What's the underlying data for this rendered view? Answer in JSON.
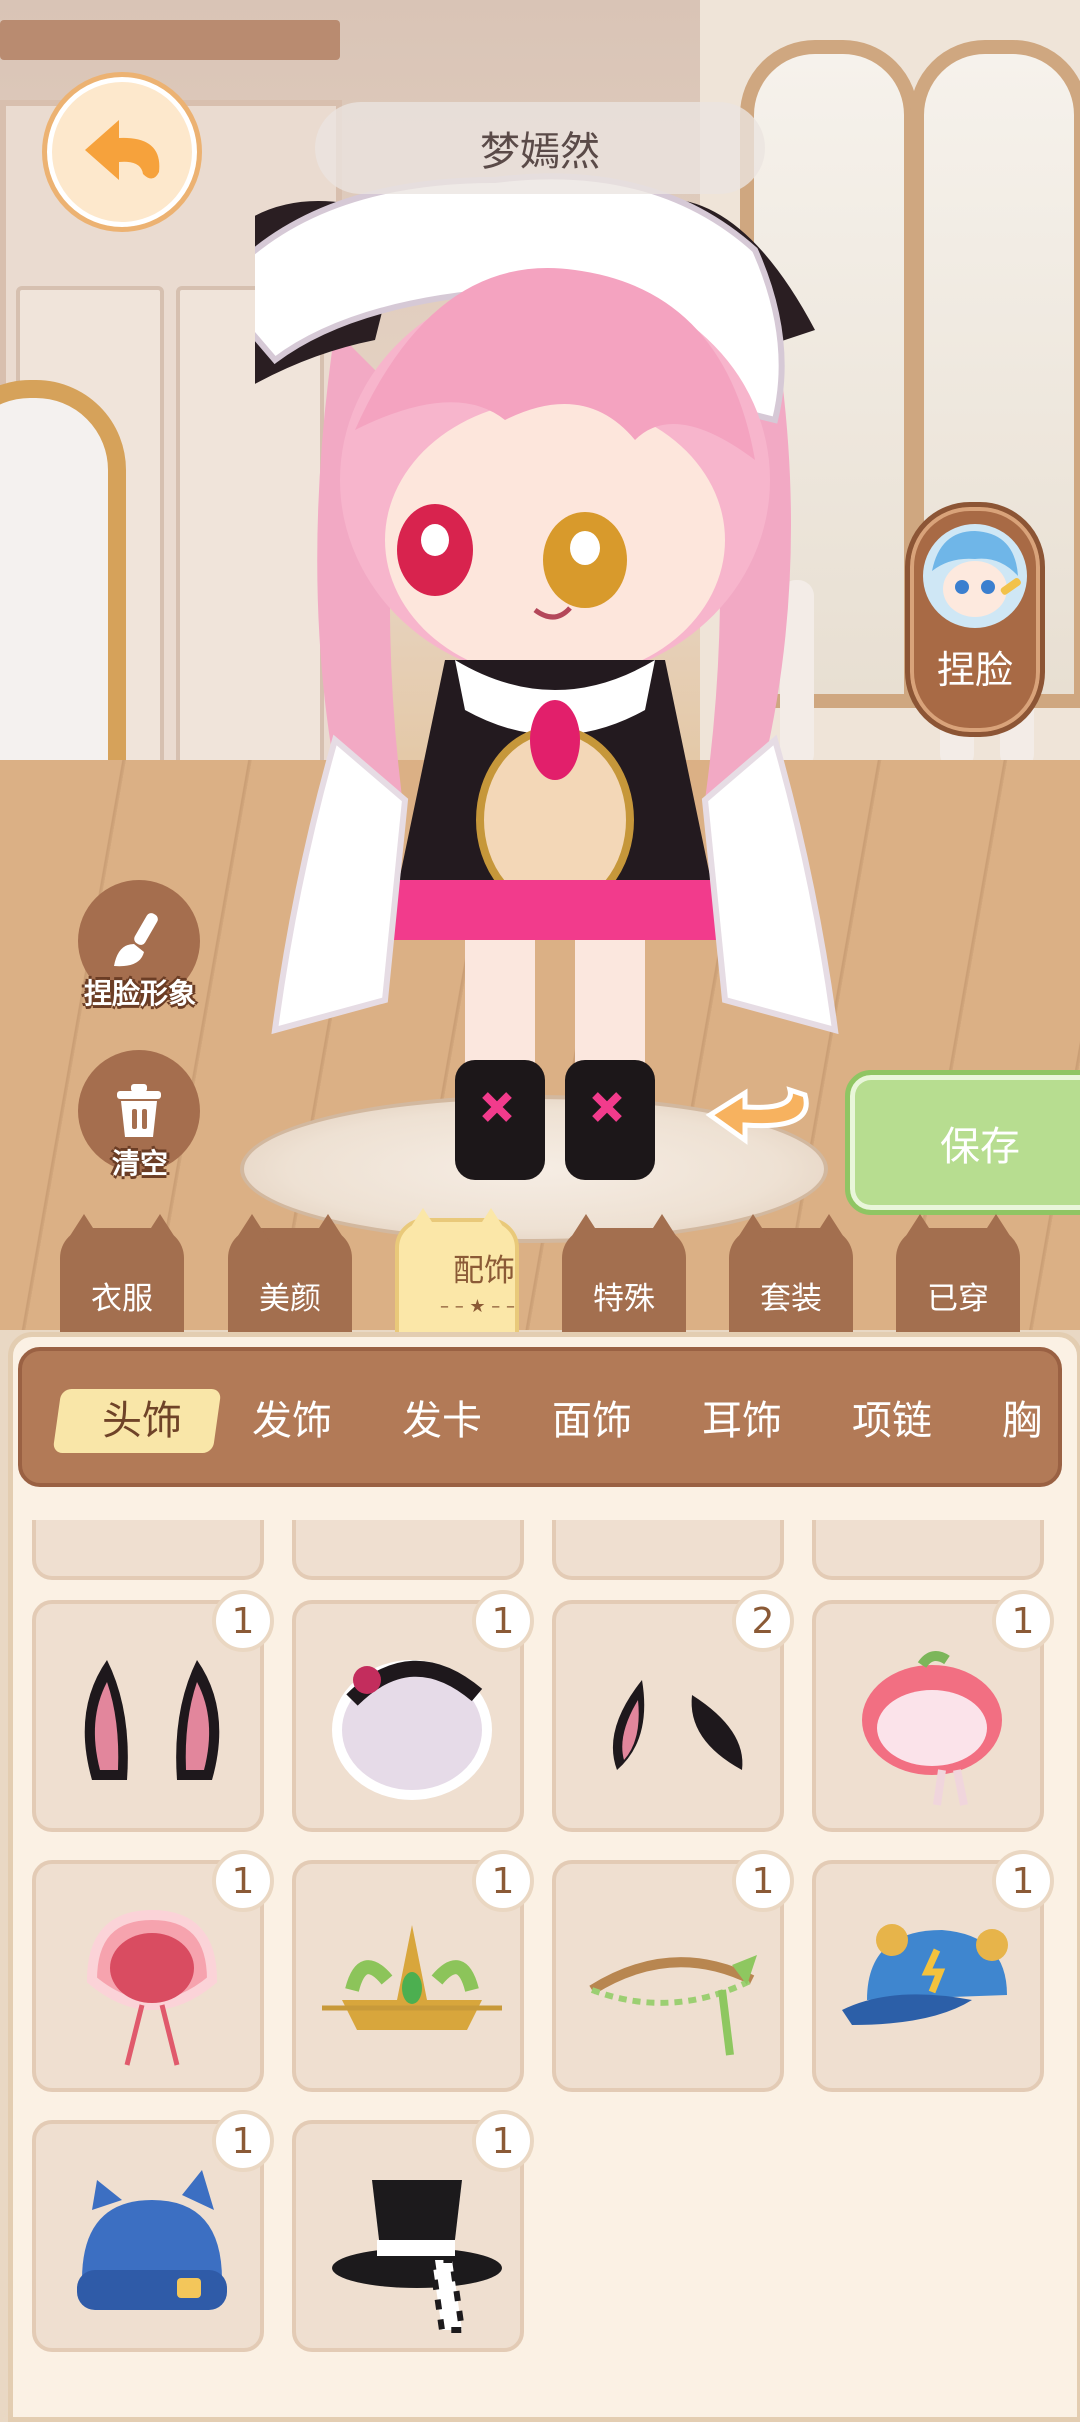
{
  "header": {
    "character_name": "梦嫣然"
  },
  "right_panel": {
    "face_button_label": "捏脸",
    "save_label": "保存"
  },
  "left_tools": {
    "face_shape_label": "捏脸形象",
    "clear_label": "清空"
  },
  "category_tabs": [
    {
      "label": "衣服",
      "active": false
    },
    {
      "label": "美颜",
      "active": false
    },
    {
      "label": "配饰",
      "active": true
    },
    {
      "label": "特殊",
      "active": false
    },
    {
      "label": "套装",
      "active": false
    },
    {
      "label": "已穿",
      "active": false
    }
  ],
  "subcategory_tabs": [
    {
      "label": "头饰",
      "active": true
    },
    {
      "label": "发饰",
      "active": false
    },
    {
      "label": "发卡",
      "active": false
    },
    {
      "label": "面饰",
      "active": false
    },
    {
      "label": "耳饰",
      "active": false
    },
    {
      "label": "项链",
      "active": false
    },
    {
      "label": "胸",
      "active": false
    }
  ],
  "items": [
    {
      "icon": "bunny-ears-icon",
      "count": "1"
    },
    {
      "icon": "frilly-bonnet-icon",
      "count": "1"
    },
    {
      "icon": "small-bunny-ears-icon",
      "count": "2"
    },
    {
      "icon": "peach-hat-icon",
      "count": "1"
    },
    {
      "icon": "pink-bonnet-icon",
      "count": "1"
    },
    {
      "icon": "gold-crown-icon",
      "count": "1"
    },
    {
      "icon": "vine-circlet-icon",
      "count": "1"
    },
    {
      "icon": "blue-cap-icon",
      "count": "1"
    },
    {
      "icon": "blue-beanie-icon",
      "count": "1"
    },
    {
      "icon": "top-hat-icon",
      "count": "1"
    }
  ],
  "colors": {
    "accent_brown": "#a36f4f",
    "save_green": "#b7dd90",
    "panel_bg": "#fbf1e4"
  }
}
